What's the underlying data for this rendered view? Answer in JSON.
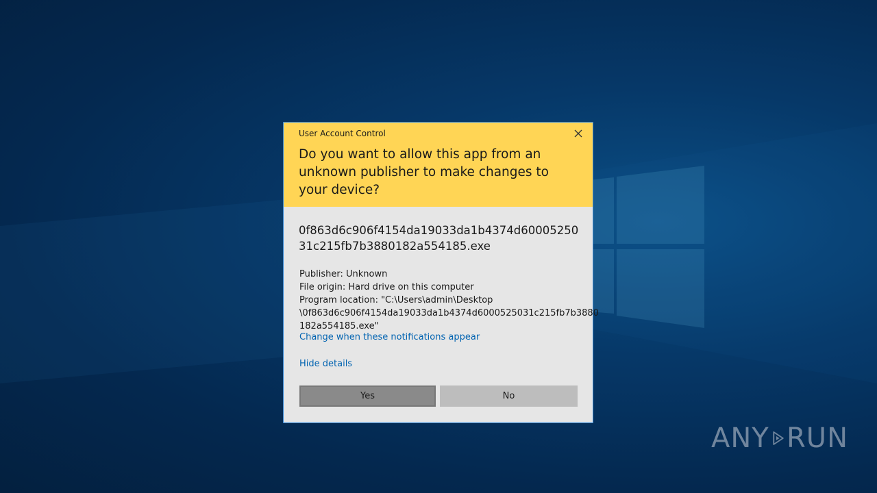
{
  "dialog": {
    "title": "User Account Control",
    "question": "Do you want to allow this app from an unknown publisher to make changes to your device?",
    "program_name": "0f863d6c906f4154da19033da1b4374d6000525031c215fb7b3880182a554185.exe",
    "publisher": "Publisher: Unknown",
    "file_origin": "File origin: Hard drive on this computer",
    "program_location": "Program location: \"C:\\Users\\admin\\Desktop\n\\0f863d6c906f4154da19033da1b4374d6000525031c215fb7b3880\n182a554185.exe\"",
    "change_link": "Change when these notifications appear",
    "hide_details": "Hide details",
    "yes_label": "Yes",
    "no_label": "No"
  },
  "watermark": {
    "left_text": "ANY",
    "right_text": "RUN"
  },
  "colors": {
    "header": "#ffd555",
    "body": "#e6e6e6",
    "link": "#0063b1",
    "yes_button": "#8a8a8a",
    "no_button": "#bdbdbd"
  }
}
